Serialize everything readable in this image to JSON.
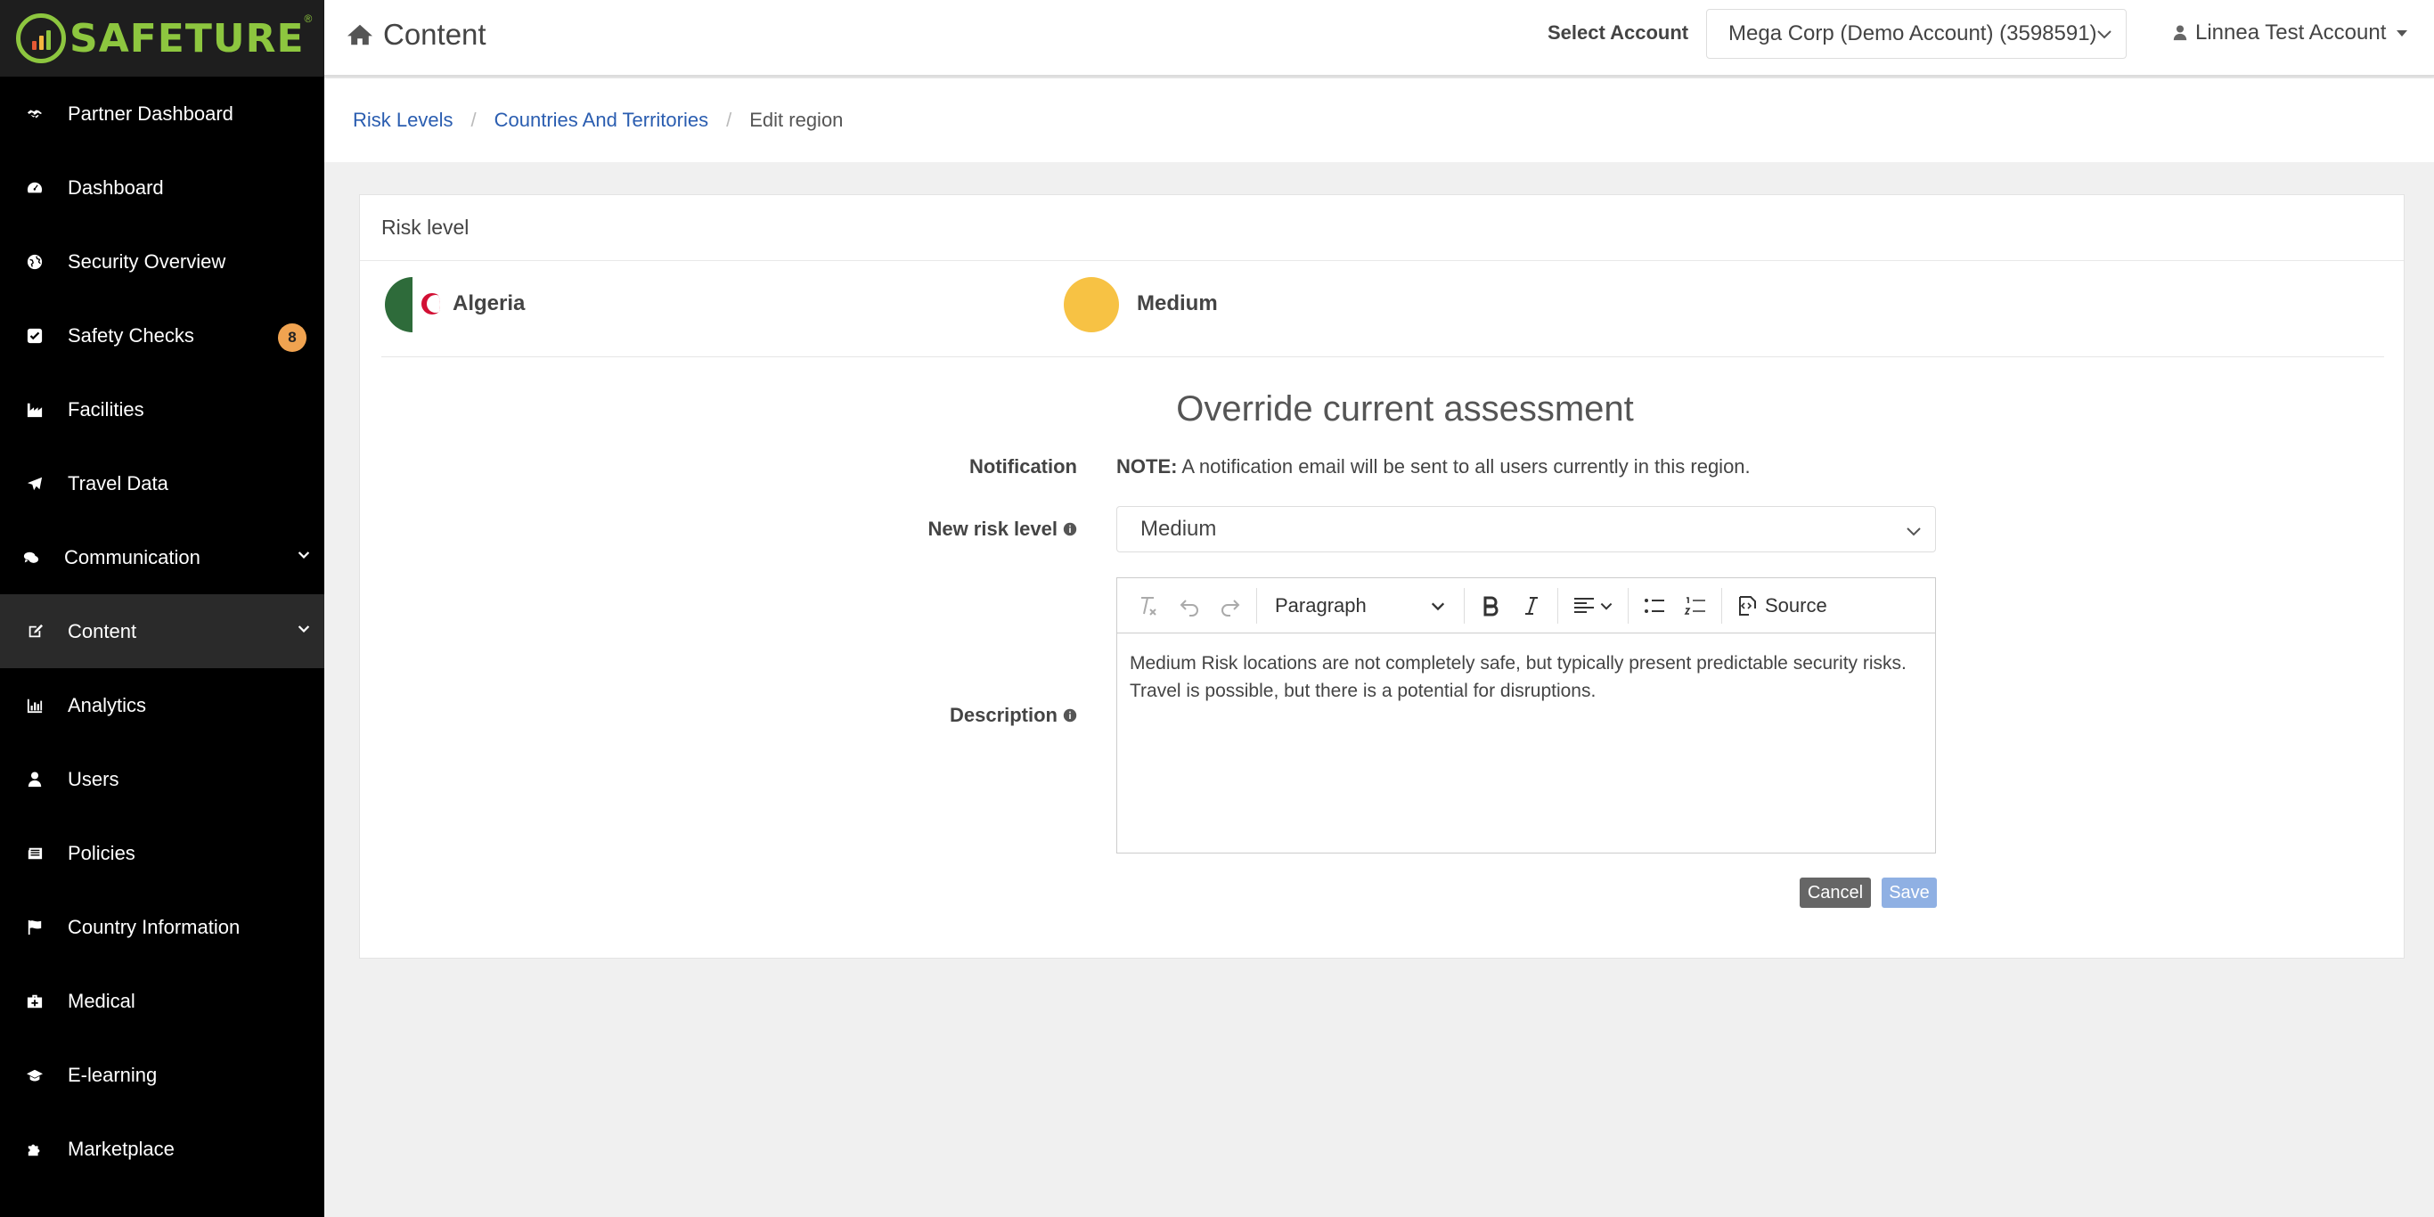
{
  "brand": {
    "name": "SAFETURE",
    "reg": "®"
  },
  "sidebar": {
    "items": [
      {
        "label": "Partner Dashboard",
        "icon": "handshake-icon"
      },
      {
        "label": "Dashboard",
        "icon": "dashboard-icon"
      },
      {
        "label": "Security Overview",
        "icon": "globe-icon"
      },
      {
        "label": "Safety Checks",
        "icon": "checkbox-icon",
        "badge": "8"
      },
      {
        "label": "Facilities",
        "icon": "industry-icon"
      },
      {
        "label": "Travel Data",
        "icon": "plane-icon"
      },
      {
        "label": "Communication",
        "icon": "comments-icon"
      },
      {
        "label": "Content",
        "icon": "edit-icon"
      },
      {
        "label": "Analytics",
        "icon": "bar-chart-icon"
      },
      {
        "label": "Users",
        "icon": "user-icon"
      },
      {
        "label": "Policies",
        "icon": "newspaper-icon"
      },
      {
        "label": "Country Information",
        "icon": "flag-icon"
      },
      {
        "label": "Medical",
        "icon": "medkit-icon"
      },
      {
        "label": "E-learning",
        "icon": "graduation-cap-icon"
      },
      {
        "label": "Marketplace",
        "icon": "puzzle-icon"
      }
    ],
    "badge_color": "#f0a350"
  },
  "header": {
    "title": "Content",
    "account_label": "Select Account",
    "account_value": "Mega Corp (Demo Account) (3598591)",
    "user": "Linnea Test Account"
  },
  "breadcrumb": {
    "items": [
      "Risk Levels",
      "Countries And Territories"
    ],
    "current": "Edit region"
  },
  "card": {
    "header": "Risk level",
    "country": "Algeria",
    "risk": "Medium",
    "risk_color": "#f7c244"
  },
  "form": {
    "title": "Override current assessment",
    "notification_label": "Notification",
    "note_strong": "NOTE:",
    "note_text": " A notification email will be sent to all users currently in this region.",
    "risk_label": "New risk level",
    "risk_value": "Medium",
    "description_label": "Description",
    "paragraph_label": "Paragraph",
    "source_label": "Source",
    "description_text": "Medium Risk locations are not completely safe, but typically present predictable security risks. Travel is possible, but there is a potential for disruptions.",
    "cancel": "Cancel",
    "save": "Save"
  }
}
